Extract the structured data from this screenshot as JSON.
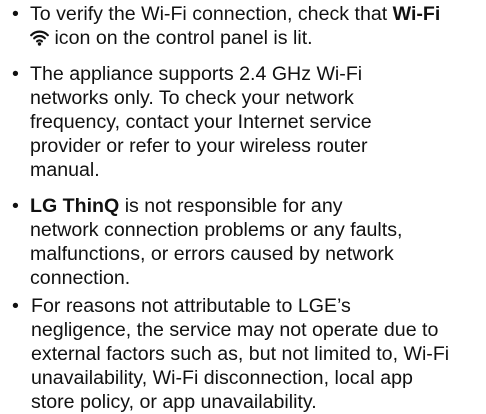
{
  "bullet_symbol": "•",
  "items": [
    {
      "lines": [
        {
          "pre": "To verify the Wi-Fi connection, check that ",
          "bold": "Wi-Fi"
        },
        {
          "post": " icon on the control panel is lit."
        }
      ],
      "icon": "wifi-icon"
    },
    {
      "lines": [
        "The appliance supports 2.4 GHz Wi-Fi",
        "networks only. To check your network",
        "frequency, contact your Internet service",
        "provider or refer to your wireless router",
        "manual."
      ]
    },
    {
      "bold": "LG ThinQ",
      "lines": [
        " is not responsible for any",
        "network connection problems or any faults,",
        "malfunctions, or errors caused by network",
        "connection."
      ]
    },
    {
      "lines": [
        "For reasons not attributable to LGE’s",
        "negligence, the service may not operate due to",
        "external factors such as, but not limited to, Wi-Fi",
        "unavailability, Wi-Fi disconnection, local app",
        "store policy, or app unavailability."
      ]
    }
  ]
}
